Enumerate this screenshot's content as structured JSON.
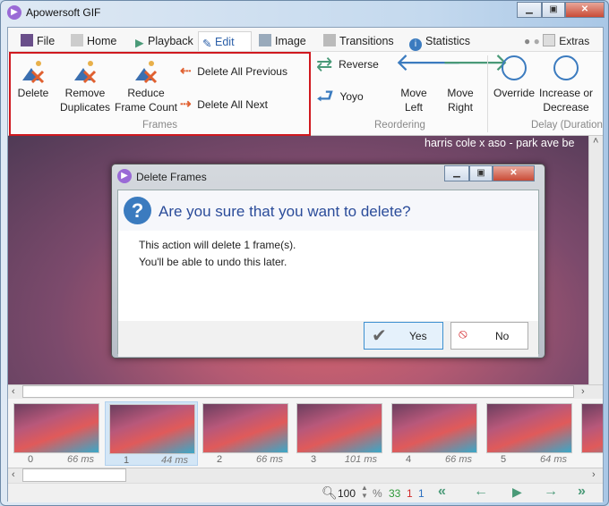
{
  "app": {
    "title": "Apowersoft GIF"
  },
  "tabs": [
    {
      "label": "File"
    },
    {
      "label": "Home"
    },
    {
      "label": "Playback"
    },
    {
      "label": "Edit",
      "active": true
    },
    {
      "label": "Image"
    },
    {
      "label": "Transitions"
    },
    {
      "label": "Statistics"
    }
  ],
  "extras_label": "Extras",
  "ribbon": {
    "frames": {
      "label": "Frames",
      "delete": "Delete",
      "remove_duplicates": [
        "Remove",
        "Duplicates"
      ],
      "reduce": [
        "Reduce",
        "Frame Count"
      ],
      "delete_all_previous": "Delete All Previous",
      "delete_all_next": "Delete All Next"
    },
    "reordering": {
      "label": "Reordering",
      "reverse": "Reverse",
      "yoyo": "Yoyo",
      "move_left": [
        "Move",
        "Left"
      ],
      "move_right": [
        "Move",
        "Right"
      ]
    },
    "delay": {
      "label": "Delay (Duration)",
      "override": "Override",
      "increase": [
        "Increase or",
        "Decrease"
      ]
    }
  },
  "canvas": {
    "overlay_text": "harris cole x aso - park ave be"
  },
  "frames": [
    {
      "index": "0",
      "delay": "66 ms"
    },
    {
      "index": "1",
      "delay": "44 ms",
      "selected": true
    },
    {
      "index": "2",
      "delay": "66 ms"
    },
    {
      "index": "3",
      "delay": "101 ms"
    },
    {
      "index": "4",
      "delay": "66 ms"
    },
    {
      "index": "5",
      "delay": "64 ms"
    }
  ],
  "status": {
    "zoom": "100",
    "percent": "%",
    "frame_count": "33",
    "selected_count": "1",
    "current_frame": "1"
  },
  "dialog": {
    "title": "Delete Frames",
    "heading": "Are you sure that you want to delete?",
    "line1": "This action will delete 1 frame(s).",
    "line2": "You'll be able to undo this later.",
    "yes": "Yes",
    "no": "No"
  },
  "colors": {
    "highlight_box": "#d0191f",
    "accent_blue": "#2b5fa8",
    "green_arrow": "#4a9a78"
  }
}
